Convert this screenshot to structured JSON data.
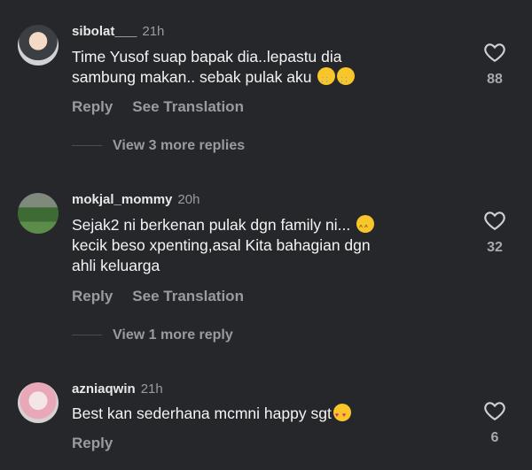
{
  "comments": [
    {
      "username": "sibolat___",
      "time": "21h",
      "text": "Time Yusof suap bapak dia..lepastu dia sambung makan.. sebak pulak aku",
      "emoji": "😭😭",
      "actions": [
        "Reply",
        "See Translation"
      ],
      "more_replies": "View 3 more replies",
      "likes": "88"
    },
    {
      "username": "mokjal_mommy",
      "time": "20h",
      "text": "Sejak2 ni berkenan pulak dgn family ni...😂 kecik beso xpenting,asal Kita bahagian dgn ahli keluarga",
      "emoji": "😂",
      "actions": [
        "Reply",
        "See Translation"
      ],
      "more_replies": "View 1 more reply",
      "likes": "32"
    },
    {
      "username": "azniaqwin",
      "time": "21h",
      "text": "Best kan sederhana mcmni happy sgt",
      "emoji": "😍",
      "actions": [
        "Reply"
      ],
      "likes": "6"
    }
  ],
  "icons": {
    "like": "heart-outline-icon"
  },
  "colors": {
    "background": "#26272b",
    "muted": "#9a9ba0"
  }
}
